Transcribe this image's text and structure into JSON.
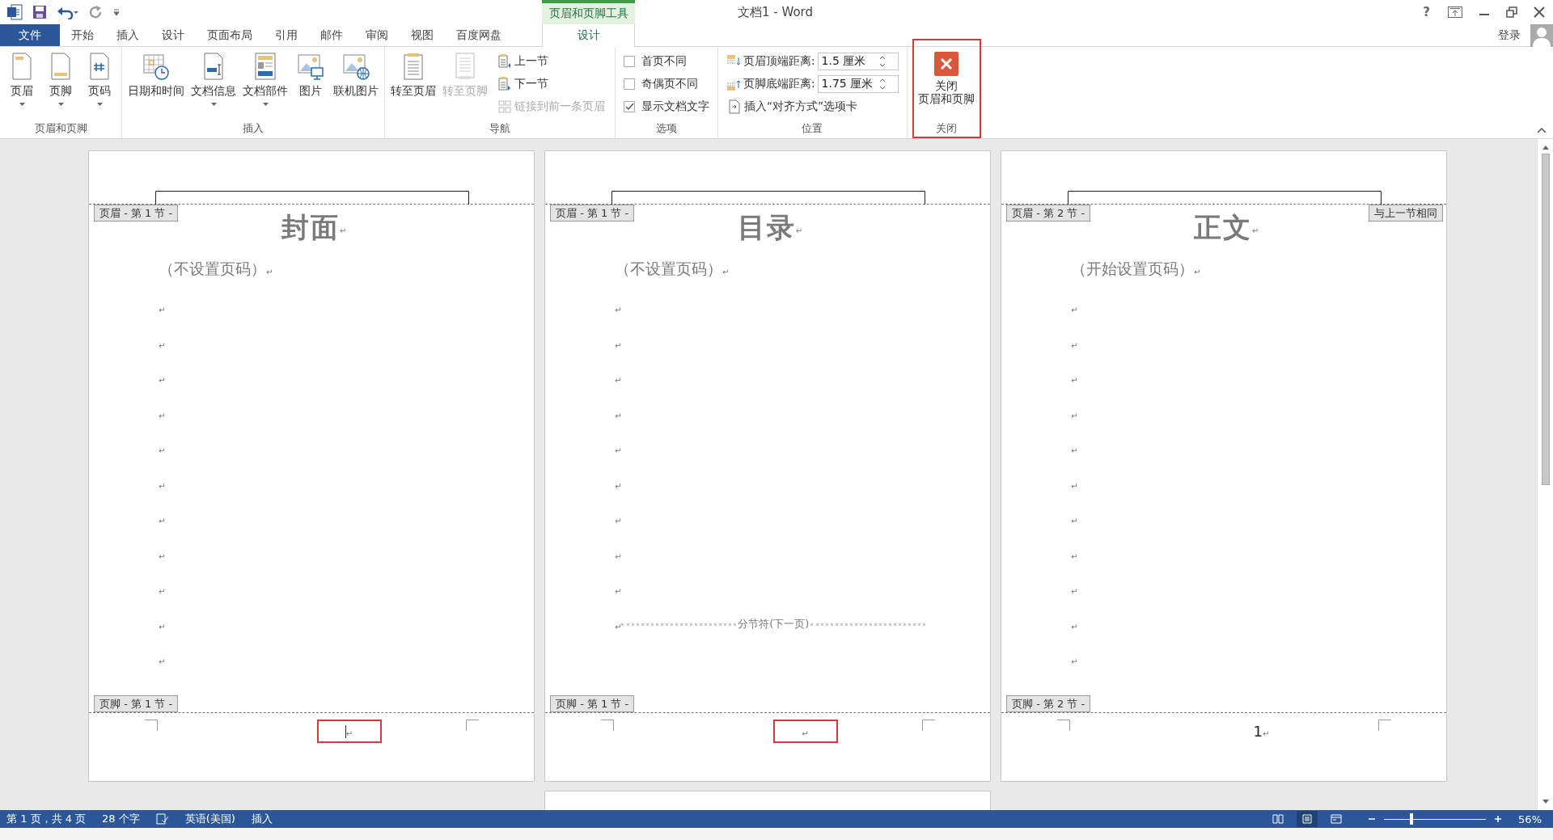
{
  "window": {
    "title": "文档1 - Word",
    "help": "?"
  },
  "contextual_group": "页眉和页脚工具",
  "tabs": [
    {
      "label": "文件",
      "kind": "file",
      "selected": false
    },
    {
      "label": "开始",
      "kind": "normal",
      "selected": false
    },
    {
      "label": "插入",
      "kind": "normal",
      "selected": false
    },
    {
      "label": "设计",
      "kind": "normal",
      "selected": false
    },
    {
      "label": "页面布局",
      "kind": "normal",
      "selected": false
    },
    {
      "label": "引用",
      "kind": "normal",
      "selected": false
    },
    {
      "label": "邮件",
      "kind": "normal",
      "selected": false
    },
    {
      "label": "审阅",
      "kind": "normal",
      "selected": false
    },
    {
      "label": "视图",
      "kind": "normal",
      "selected": false
    },
    {
      "label": "百度网盘",
      "kind": "normal",
      "selected": false
    },
    {
      "label": "设计",
      "kind": "contextual",
      "selected": true
    }
  ],
  "account": {
    "label": "登录"
  },
  "ribbon_groups": [
    {
      "label": "页眉和页脚",
      "items": [
        {
          "kind": "large",
          "label": "页眉",
          "dropdown": true,
          "disabled": false
        },
        {
          "kind": "large",
          "label": "页脚",
          "dropdown": true,
          "disabled": false
        },
        {
          "kind": "large",
          "label": "页码",
          "dropdown": true,
          "disabled": false
        }
      ]
    },
    {
      "label": "插入",
      "items": [
        {
          "kind": "large",
          "label": "日期和时间",
          "dropdown": false,
          "disabled": false
        },
        {
          "kind": "large",
          "label": "文档信息",
          "dropdown": true,
          "disabled": false
        },
        {
          "kind": "large",
          "label": "文档部件",
          "dropdown": true,
          "disabled": false
        },
        {
          "kind": "large",
          "label": "图片",
          "dropdown": false,
          "disabled": false
        },
        {
          "kind": "large",
          "label": "联机图片",
          "dropdown": false,
          "disabled": false
        }
      ]
    },
    {
      "label": "导航",
      "items": [
        {
          "kind": "large",
          "label": "转至页眉",
          "dropdown": false,
          "disabled": false
        },
        {
          "kind": "large",
          "label": "转至页脚",
          "dropdown": false,
          "disabled": true
        },
        {
          "kind": "small",
          "label": "上一节",
          "disabled": false
        },
        {
          "kind": "small",
          "label": "下一节",
          "disabled": false
        },
        {
          "kind": "small",
          "label": "链接到前一条页眉",
          "disabled": true
        }
      ]
    },
    {
      "label": "选项",
      "items": [
        {
          "kind": "checkbox",
          "label": "首页不同",
          "checked": false
        },
        {
          "kind": "checkbox",
          "label": "奇偶页不同",
          "checked": false
        },
        {
          "kind": "checkbox",
          "label": "显示文档文字",
          "checked": true
        }
      ]
    },
    {
      "label": "位置",
      "items": [
        {
          "kind": "spin",
          "label": "页眉顶端距离:",
          "value": "1.5 厘米",
          "disabled": false
        },
        {
          "kind": "spin",
          "label": "页脚底端距离:",
          "value": "1.75 厘米",
          "disabled": false
        },
        {
          "kind": "small",
          "label": "插入“对齐方式”选项卡",
          "disabled": false
        }
      ]
    },
    {
      "label": "关闭",
      "highlighted": true,
      "items": [
        {
          "kind": "large",
          "lines": [
            "关闭",
            "页眉和页脚"
          ],
          "dropdown": false,
          "disabled": false
        }
      ]
    }
  ],
  "pages": [
    {
      "header_tag": "页眉 - 第 1 节 -",
      "paragraphs": [
        {
          "kind": "title",
          "text": "封面",
          "mark": "↵"
        },
        {
          "kind": "subtitle",
          "text": "（不设置页码）",
          "mark": "↵"
        },
        {
          "kind": "empty",
          "mark": "↵"
        },
        {
          "kind": "empty",
          "mark": "↵"
        },
        {
          "kind": "empty",
          "mark": "↵"
        },
        {
          "kind": "empty",
          "mark": "↵"
        },
        {
          "kind": "empty",
          "mark": "↵"
        },
        {
          "kind": "empty",
          "mark": "↵"
        },
        {
          "kind": "empty",
          "mark": "↵"
        },
        {
          "kind": "empty",
          "mark": "↵"
        },
        {
          "kind": "empty",
          "mark": "↵"
        },
        {
          "kind": "empty",
          "mark": "↵"
        },
        {
          "kind": "empty",
          "mark": "↵"
        }
      ],
      "footer_tag": "页脚 - 第 1 节 -",
      "footer": {
        "mark": "↵",
        "caret": true,
        "highlighted": true
      }
    },
    {
      "header_tag": "页眉 - 第 1 节 -",
      "paragraphs": [
        {
          "kind": "title",
          "text": "目录",
          "mark": "↵"
        },
        {
          "kind": "subtitle",
          "text": "（不设置页码）",
          "mark": "↵"
        },
        {
          "kind": "empty",
          "mark": "↵"
        },
        {
          "kind": "empty",
          "mark": "↵"
        },
        {
          "kind": "empty",
          "mark": "↵"
        },
        {
          "kind": "empty",
          "mark": "↵"
        },
        {
          "kind": "empty",
          "mark": "↵"
        },
        {
          "kind": "empty",
          "mark": "↵"
        },
        {
          "kind": "empty",
          "mark": "↵"
        },
        {
          "kind": "empty",
          "mark": "↵"
        },
        {
          "kind": "empty",
          "mark": "↵"
        },
        {
          "kind": "section_break",
          "text": "分节符(下一页)",
          "mark": "↵"
        }
      ],
      "footer_tag": "页脚 - 第 1 节 -",
      "footer": {
        "mark": "↵",
        "caret": false,
        "highlighted": true
      }
    },
    {
      "header_tag": "页眉 - 第 2 节 -",
      "same_as_previous": "与上一节相同",
      "paragraphs": [
        {
          "kind": "title",
          "text": "正文",
          "mark": "↵"
        },
        {
          "kind": "subtitle",
          "text": "（开始设置页码）",
          "mark": "↵"
        },
        {
          "kind": "empty",
          "mark": "↵"
        },
        {
          "kind": "empty",
          "mark": "↵"
        },
        {
          "kind": "empty",
          "mark": "↵"
        },
        {
          "kind": "empty",
          "mark": "↵"
        },
        {
          "kind": "empty",
          "mark": "↵"
        },
        {
          "kind": "empty",
          "mark": "↵"
        },
        {
          "kind": "empty",
          "mark": "↵"
        },
        {
          "kind": "empty",
          "mark": "↵"
        },
        {
          "kind": "empty",
          "mark": "↵"
        },
        {
          "kind": "empty",
          "mark": "↵"
        },
        {
          "kind": "empty",
          "mark": "↵"
        }
      ],
      "footer_tag": "页脚 - 第 2 节 -",
      "footer": {
        "text": "1",
        "mark": "↵",
        "caret": false,
        "highlighted": false
      }
    }
  ],
  "status_bar": {
    "items": [
      {
        "kind": "text",
        "text": "第 1 页，共 4 页"
      },
      {
        "kind": "text",
        "text": "28 个字"
      },
      {
        "kind": "proofing"
      },
      {
        "kind": "text",
        "text": "英语(美国)"
      },
      {
        "kind": "text",
        "text": "插入"
      }
    ],
    "views": [
      {
        "selected": false
      },
      {
        "selected": true
      },
      {
        "selected": false
      }
    ],
    "zoom": {
      "level": 0.27,
      "reading": "56%"
    }
  }
}
